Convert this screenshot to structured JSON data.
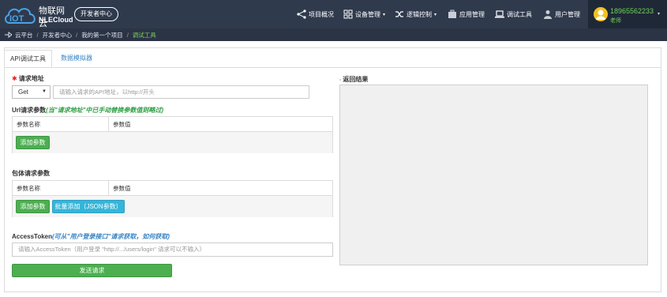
{
  "colors": {
    "topbar": "#2f3a4d",
    "green": "#4caf50",
    "cyan": "#35b5d9",
    "link": "#3b84c4"
  },
  "brand": {
    "cn": "物联网云",
    "en": "NLECloud"
  },
  "header": {
    "dev_center": "开发者中心",
    "nav": [
      {
        "label": "项目概况",
        "icon": "share-nodes-icon",
        "caret": ""
      },
      {
        "label": "设备管理",
        "icon": "grid-icon",
        "caret": "▾"
      },
      {
        "label": "逻辑控制",
        "icon": "shuffle-icon",
        "caret": "▾"
      },
      {
        "label": "应用管理",
        "icon": "briefcase-icon",
        "caret": ""
      },
      {
        "label": "调试工具",
        "icon": "laptop-icon",
        "caret": ""
      },
      {
        "label": "用户管理",
        "icon": "user-icon",
        "caret": ""
      }
    ],
    "user": {
      "name": "18965562233",
      "role": "老师"
    }
  },
  "breadcrumb": {
    "items": [
      "云平台",
      "开发者中心",
      "我的第一个项目"
    ],
    "active": "调试工具"
  },
  "tabs": [
    "API调试工具",
    "数据模拟器"
  ],
  "form": {
    "url_label": "请求地址",
    "method": "Get",
    "url_placeholder": "请输入请求的API地址，以http://开头",
    "url_params_label": "Url请求参数",
    "url_params_hint": "(当\"请求地址\"中已手动替换参数值则略过)",
    "col_name": "参数名称",
    "col_value": "参数值",
    "add_param": "添加参数",
    "body_params_label": "包体请求参数",
    "batch_add": "批量添加（JSON参数）",
    "token_label": "AccessToken",
    "token_hint": "(可从\"用户登录接口\"请求获取，如何获取)",
    "token_placeholder": "请输入AccessToken（用户登录 \"http://.../users/login\" 请求可以不输入）",
    "send": "发送请求"
  },
  "result": {
    "label": "返回结果"
  }
}
